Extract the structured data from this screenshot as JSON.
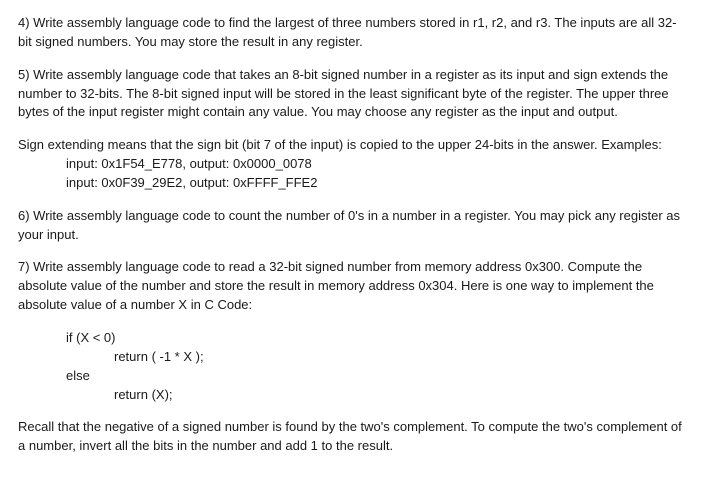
{
  "q4": {
    "text": "4)  Write assembly language code to find the largest of three numbers stored in r1, r2, and r3.  The inputs are all 32-bit signed numbers.  You may store the result in any register."
  },
  "q5": {
    "text": "5)  Write assembly language code that takes an 8-bit signed number in a register as its input and sign extends the number to 32-bits.  The 8-bit signed input will be stored in the least significant byte of the register.  The upper three bytes of the input register might contain any value. You may choose any register as the input and output."
  },
  "sign_ext": {
    "desc": "Sign extending means that the sign bit (bit 7 of the input) is copied to the upper 24-bits in the answer. Examples:",
    "ex1": "input:  0x1F54_E778,  output:  0x0000_0078",
    "ex2": "input:  0x0F39_29E2,  output:  0xFFFF_FFE2"
  },
  "q6": {
    "text": "6)  Write assembly language code to count the number of 0's in a number in a register.  You may pick any register as your input."
  },
  "q7": {
    "text": "7)  Write assembly language code to read a 32-bit signed number from memory address 0x300. Compute the absolute value of the number and store the result in memory address 0x304.  Here is one way to implement the absolute value of a number X in C Code:"
  },
  "code": {
    "l1": "if (X < 0)",
    "l2": "return ( -1 * X );",
    "l3": "else",
    "l4": "return (X);"
  },
  "recall": {
    "text": "Recall that the negative of a signed number is found by the two's complement.  To compute the two's complement of a number, invert all the bits in the number and add 1 to the result."
  }
}
